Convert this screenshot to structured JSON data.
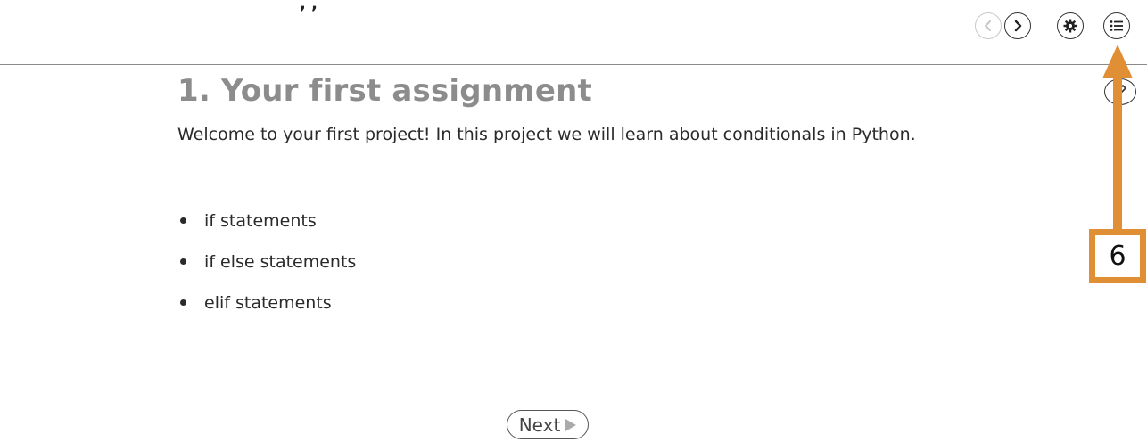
{
  "header": {
    "fragment": ", ,",
    "buttons": [
      {
        "name": "previous-button",
        "icon": "chevron-left-icon",
        "enabled": false
      },
      {
        "name": "next-page-button",
        "icon": "chevron-right-icon",
        "enabled": true
      },
      {
        "name": "settings-button",
        "icon": "gear-icon",
        "enabled": true
      },
      {
        "name": "table-of-contents-button",
        "icon": "list-icon",
        "enabled": true
      }
    ]
  },
  "content": {
    "title": "1. Your first assignment",
    "intro": "Welcome to your first project! In this project we will learn about conditionals in Python.",
    "topics": [
      "if statements",
      "if else statements",
      "elif statements"
    ]
  },
  "annotation": {
    "label": "6",
    "color": "#e18f35"
  },
  "footer": {
    "next_label": "Next"
  }
}
